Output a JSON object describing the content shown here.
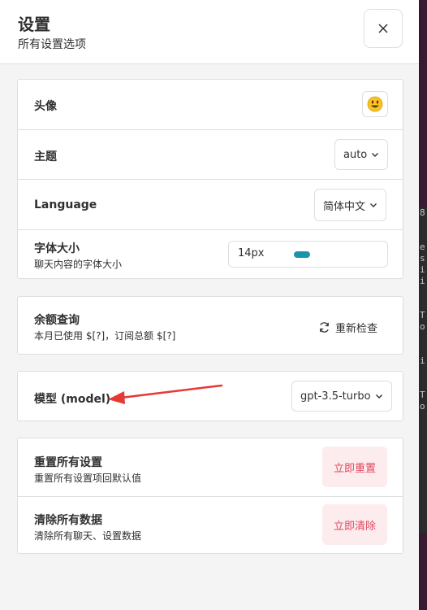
{
  "header": {
    "title": "设置",
    "subtitle": "所有设置选项"
  },
  "settings": {
    "avatar": {
      "label": "头像",
      "emoji": "😃"
    },
    "theme": {
      "label": "主题",
      "value": "auto"
    },
    "language": {
      "label": "Language",
      "value": "简体中文"
    },
    "font_size": {
      "label": "字体大小",
      "description": "聊天内容的字体大小",
      "value": "14px",
      "slider_fraction": 0.45
    },
    "balance": {
      "label": "余额查询",
      "description": "本月已使用 $[?]，订阅总额 $[?]",
      "action": "重新检查"
    },
    "model": {
      "label": "模型 (model)",
      "value": "gpt-3.5-turbo"
    },
    "reset": {
      "label": "重置所有设置",
      "description": "重置所有设置项回默认值",
      "action": "立即重置"
    },
    "clear": {
      "label": "清除所有数据",
      "description": "清除所有聊天、设置数据",
      "action": "立即清除"
    }
  },
  "background_terminal": {
    "lines": [
      "8",
      "",
      "",
      "e",
      "s",
      "i",
      "i",
      "",
      "",
      "T",
      "o",
      "",
      "",
      "i",
      "",
      "",
      "T",
      "o"
    ]
  },
  "colors": {
    "accent": "#1d93ab",
    "danger_text": "#e0475e",
    "danger_bg": "#fdecee",
    "annotation_arrow": "#e53935"
  }
}
